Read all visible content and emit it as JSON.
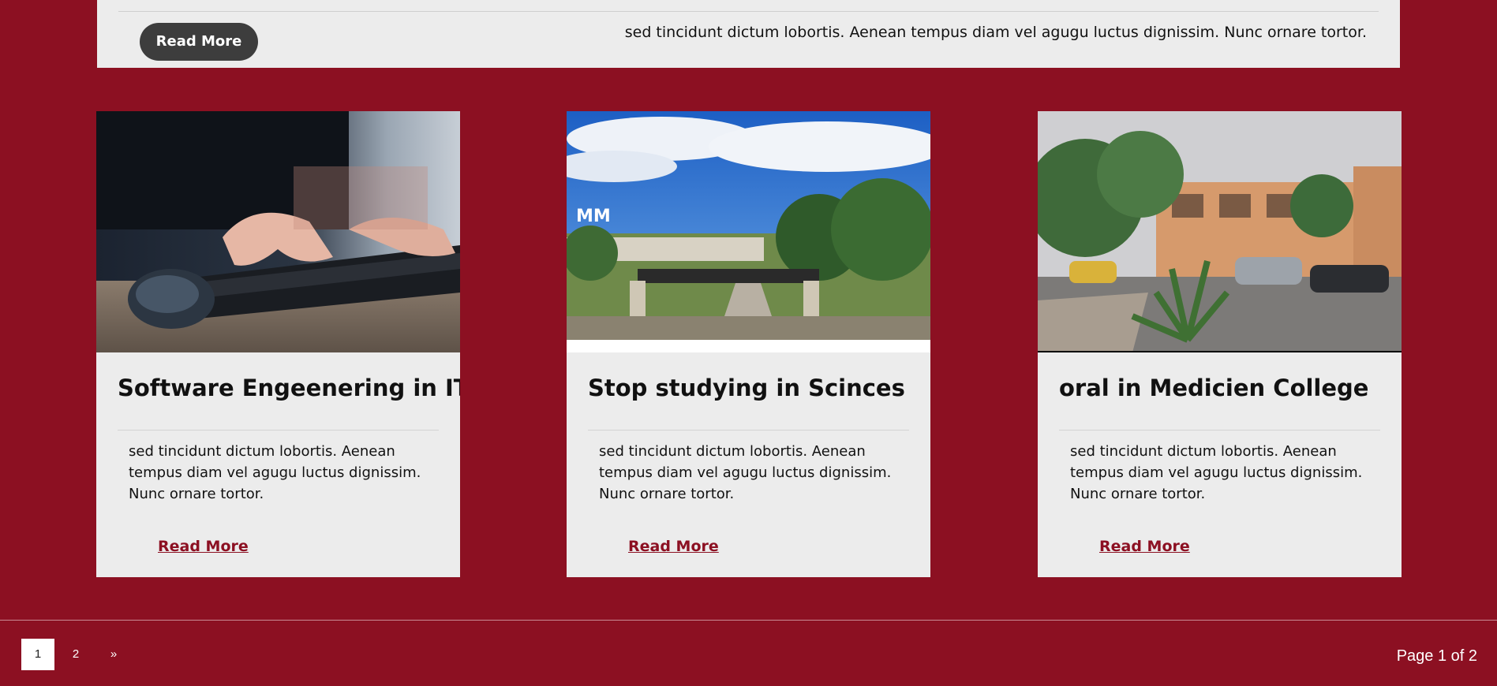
{
  "top_panel": {
    "read_more_label": "Read More",
    "excerpt": "sed tincidunt dictum lobortis. Aenean tempus diam vel agugu luctus dignissim. Nunc ornare tortor."
  },
  "cards": [
    {
      "title": "Software Engeenering in IT",
      "excerpt": "sed tincidunt dictum lobortis. Aenean tempus diam vel agugu luctus dignissim. Nunc ornare tortor.",
      "link": "Read More",
      "image": "hands-typing-keyboard-photo"
    },
    {
      "title": "Stop studying in Scinces",
      "excerpt": "sed tincidunt dictum lobortis. Aenean tempus diam vel agugu luctus dignissim. Nunc ornare tortor.",
      "link": "Read More",
      "image": "university-campus-gate-photo"
    },
    {
      "title": "oral in Medicien College",
      "excerpt": "sed tincidunt dictum lobortis. Aenean tempus diam vel agugu luctus dignissim. Nunc ornare tortor.",
      "link": "Read More",
      "image": "college-street-photo"
    }
  ],
  "pagination": {
    "pages": [
      "1",
      "2"
    ],
    "next": "»",
    "current": 1,
    "info": "Page 1 of 2"
  },
  "colors": {
    "background": "#8c1022",
    "panel": "#ececec",
    "dark_button": "#3d3d3d",
    "link": "#8c1022"
  }
}
